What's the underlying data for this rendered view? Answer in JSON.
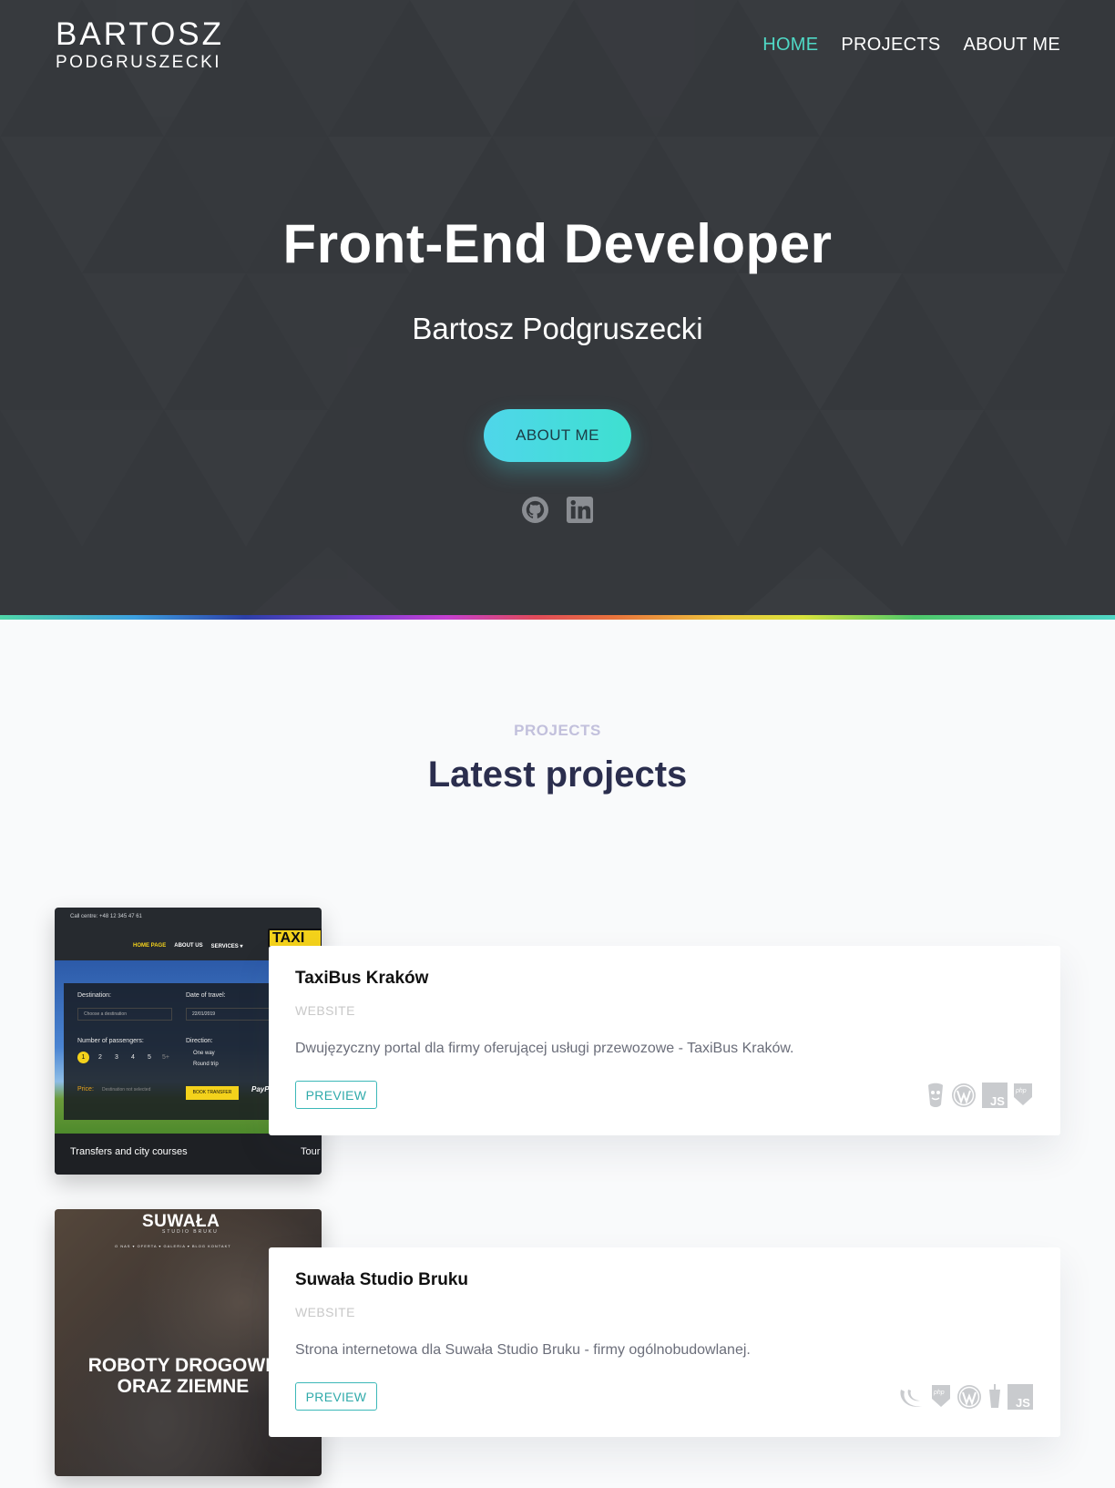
{
  "header": {
    "logo_line1": "BARTOSZ",
    "logo_line2": "PODGRUSZECKI",
    "nav": [
      {
        "label": "HOME",
        "active": true
      },
      {
        "label": "PROJECTS",
        "active": false
      },
      {
        "label": "ABOUT ME",
        "active": false
      }
    ]
  },
  "hero": {
    "title": "Front-End Developer",
    "subtitle": "Bartosz Podgruszecki",
    "cta_label": "ABOUT ME",
    "socials": [
      "github-icon",
      "linkedin-icon"
    ]
  },
  "projects_section": {
    "label": "PROJECTS",
    "title": "Latest projects"
  },
  "projects": [
    {
      "name": "TaxiBus Kraków",
      "category": "WEBSITE",
      "description": "Dwujęzyczny portal dla firmy oferującej usługi przewozowe - TaxiBus Kraków.",
      "preview_label": "PREVIEW",
      "tech_icons": [
        "gulp-icon",
        "wordpress-icon",
        "javascript-icon",
        "php-icon"
      ],
      "thumbnail": {
        "call": "Call centre: +48 12 345 47 61",
        "menu": [
          "HOME PAGE",
          "ABOUT US",
          "SERVICES ▾"
        ],
        "sign": "TAXI",
        "destination_label": "Destination:",
        "destination_placeholder": "Choose a destination",
        "date_label": "Date of travel:",
        "date_value": "22/01/2019",
        "passengers_label": "Number of passengers:",
        "passenger_numbers": [
          "1",
          "2",
          "3",
          "4",
          "5",
          "5+"
        ],
        "direction_label": "Direction:",
        "direction_options": [
          "One way",
          "Round trip"
        ],
        "price_label": "Price:",
        "price_hint": "Destination not selected",
        "book_label": "BOOK TRANSFER",
        "paypal": "PayPal",
        "footer_left": "Transfers and city courses",
        "footer_right": "Tour"
      }
    },
    {
      "name": "Suwała Studio Bruku",
      "category": "WEBSITE",
      "description": "Strona internetowa dla Suwała Studio Bruku - firmy ogólnobudowlanej.",
      "preview_label": "PREVIEW",
      "tech_icons": [
        "jquery-icon",
        "php-icon",
        "wordpress-icon",
        "gulp-icon",
        "javascript-icon"
      ],
      "thumbnail": {
        "brand": "SUWAŁA",
        "brand_sub": "STUDIO BRUKU",
        "menu": "O NAS ▾   OFERTA ▾   GALERIA ▾   BLOG   KONTAKT",
        "headline_line1": "ROBOTY DROGOWE",
        "headline_line2": "ORAZ ZIEMNE"
      }
    }
  ],
  "colors": {
    "hero_bg": "#35383c",
    "accent": "#4fd9c6",
    "button_gradient": [
      "#4fd6ea",
      "#3ee0d0"
    ],
    "preview_border": "#3cb8b8"
  }
}
